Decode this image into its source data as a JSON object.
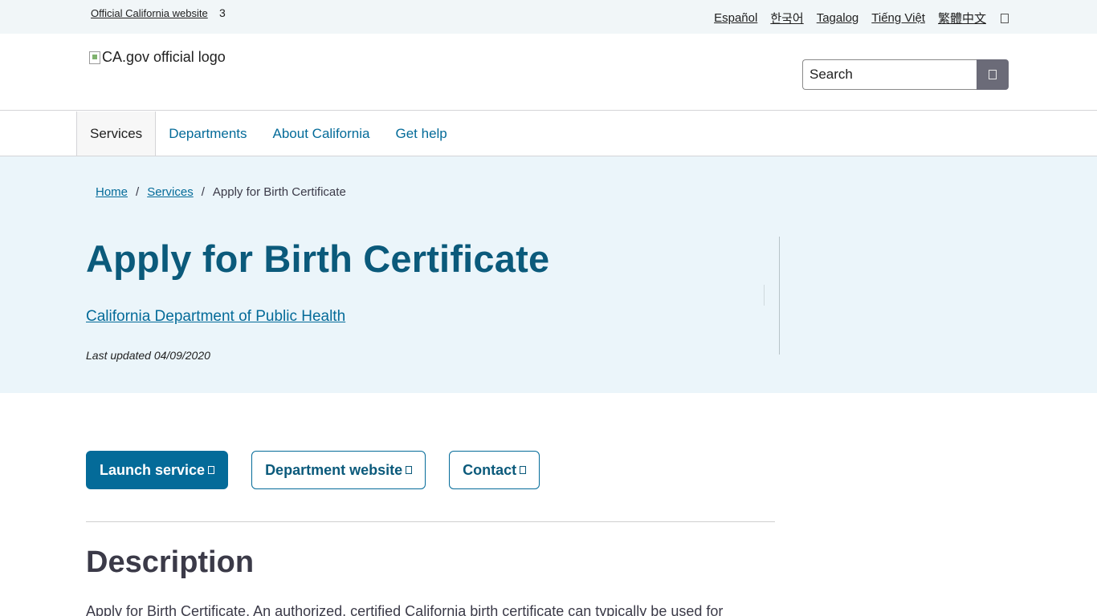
{
  "utility": {
    "official_label": "Official California website",
    "official_glyph": "3",
    "languages": [
      "Español",
      "한국어",
      "Tagalog",
      "Tiếng Việt",
      "繁體中文"
    ]
  },
  "branding": {
    "logo_alt": "CA.gov official logo",
    "search_placeholder": "Search"
  },
  "nav": {
    "items": [
      "Services",
      "Departments",
      "About California",
      "Get help"
    ]
  },
  "breadcrumb": {
    "home": "Home",
    "sep": "/",
    "services": "Services",
    "current": "Apply for Birth Certificate"
  },
  "hero": {
    "title": "Apply for Birth Certificate",
    "department": "California Department of Public Health",
    "last_updated": "Last updated 04/09/2020"
  },
  "actions": {
    "launch": "Launch service",
    "department_website": "Department website",
    "contact": "Contact"
  },
  "description": {
    "title": "Description",
    "text": "Apply for Birth Certificate. An authorized, certified California birth certificate can typically be used for"
  },
  "colors": {
    "primary": "#046b99",
    "title": "#0b5a7b",
    "hero_bg": "#ebf5fa",
    "utility_bg": "#f1f6f8"
  }
}
